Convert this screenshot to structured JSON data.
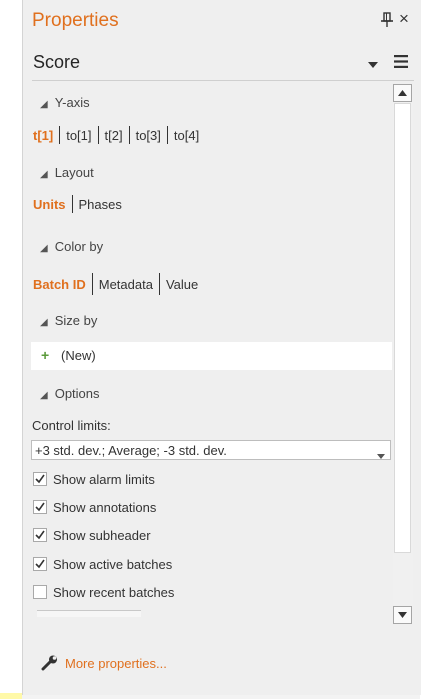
{
  "panel": {
    "title": "Properties"
  },
  "selector": {
    "value": "Score"
  },
  "sections": {
    "y_axis": {
      "header": "Y-axis",
      "options": [
        "t[1]",
        "to[1]",
        "t[2]",
        "to[3]",
        "to[4]"
      ],
      "active": "t[1]"
    },
    "layout": {
      "header": "Layout",
      "options": [
        "Units",
        "Phases"
      ],
      "active": "Units"
    },
    "color_by": {
      "header": "Color by",
      "options": [
        "Batch ID",
        "Metadata",
        "Value"
      ],
      "active": "Batch ID"
    },
    "size_by": {
      "header": "Size by",
      "new_label": "(New)",
      "plus": "+"
    },
    "options": {
      "header": "Options",
      "control_limits_label": "Control limits:",
      "control_limits_value": "+3 std. dev.; Average; -3 std. dev.",
      "checkboxes": [
        {
          "label": "Show alarm limits",
          "checked": true
        },
        {
          "label": "Show annotations",
          "checked": true
        },
        {
          "label": "Show subheader",
          "checked": true
        },
        {
          "label": "Show active batches",
          "checked": true
        },
        {
          "label": "Show recent batches",
          "checked": false
        }
      ]
    }
  },
  "footer": {
    "more_properties": "More properties..."
  },
  "colors": {
    "accent": "#e0701e",
    "panel_bg": "#efefef",
    "plus_green": "#5a9a3a"
  },
  "icons": {
    "close": "×",
    "pin": "pin-icon",
    "caret": "caret-down-icon",
    "menu": "hamburger-menu-icon",
    "wrench": "wrench-icon",
    "section_toggle": "◢"
  }
}
